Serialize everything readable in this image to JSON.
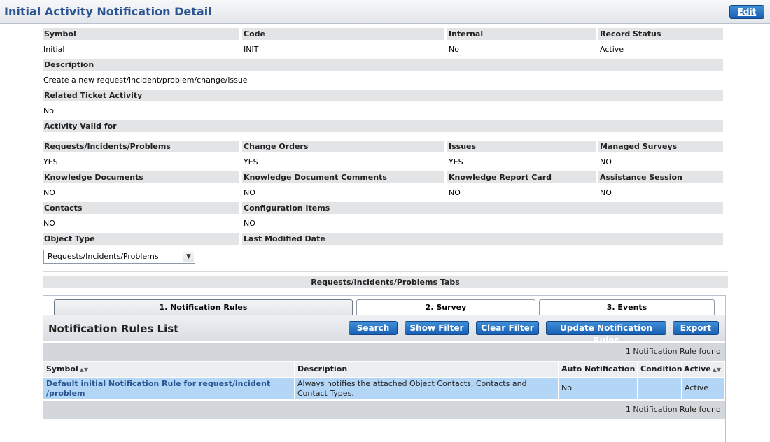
{
  "header": {
    "title": "Initial Activity Notification Detail",
    "edit_label": "Edit"
  },
  "details": {
    "symbol": {
      "label": "Symbol",
      "value": "Initial"
    },
    "code": {
      "label": "Code",
      "value": "INIT"
    },
    "internal": {
      "label": "Internal",
      "value": "No"
    },
    "record_status": {
      "label": "Record Status",
      "value": "Active"
    },
    "description": {
      "label": "Description",
      "value": "Create a new request/incident/problem/change/issue"
    },
    "related_ticket_activity": {
      "label": "Related Ticket Activity",
      "value": "No"
    },
    "activity_valid_for": {
      "label": "Activity Valid for"
    },
    "requests": {
      "label": "Requests/Incidents/Problems",
      "value": "YES"
    },
    "change_orders": {
      "label": "Change Orders",
      "value": "YES"
    },
    "issues": {
      "label": "Issues",
      "value": "YES"
    },
    "managed_surveys": {
      "label": "Managed Surveys",
      "value": "NO"
    },
    "knowledge_documents": {
      "label": "Knowledge Documents",
      "value": "NO"
    },
    "knowledge_document_comments": {
      "label": "Knowledge Document Comments",
      "value": "NO"
    },
    "knowledge_report_card": {
      "label": "Knowledge Report Card",
      "value": "NO"
    },
    "assistance_session": {
      "label": "Assistance Session",
      "value": "NO"
    },
    "contacts": {
      "label": "Contacts",
      "value": "NO"
    },
    "configuration_items": {
      "label": "Configuration Items",
      "value": "NO"
    },
    "object_type": {
      "label": "Object Type",
      "value": "Requests/Incidents/Problems"
    },
    "last_modified_date": {
      "label": "Last Modified Date",
      "value": ""
    }
  },
  "tabs_section": {
    "title": "Requests/Incidents/Problems Tabs",
    "tabs": [
      {
        "key": "1",
        "label": ". Notification Rules",
        "active": true
      },
      {
        "key": "2",
        "label": ". Survey",
        "active": false
      },
      {
        "key": "3",
        "label": ". Events",
        "active": false
      }
    ]
  },
  "list": {
    "title": "Notification Rules List",
    "buttons": {
      "search": {
        "key": "S",
        "rest": "earch"
      },
      "show_filter": {
        "pre": "Show Fi",
        "key": "l",
        "rest": "ter"
      },
      "clear_filter": {
        "pre": "Clea",
        "key": "r",
        "rest": " Filter"
      },
      "update_rules": {
        "pre": "Update ",
        "key": "N",
        "rest": "otification Rules"
      },
      "export": {
        "pre": "E",
        "key": "x",
        "rest": "port"
      }
    },
    "count_text": "1 Notification Rule found",
    "columns": [
      "Symbol",
      "Description",
      "Auto Notification",
      "Condition",
      "Active"
    ],
    "rows": [
      {
        "symbol_line1": "Default initial Notification Rule for request/incident",
        "symbol_line2": "/problem",
        "description_line1": "Always notifies the attached Object Contacts, Contacts and",
        "description_line2": "Contact Types.",
        "auto_notification": "No",
        "condition": "",
        "active": "Active"
      }
    ]
  }
}
